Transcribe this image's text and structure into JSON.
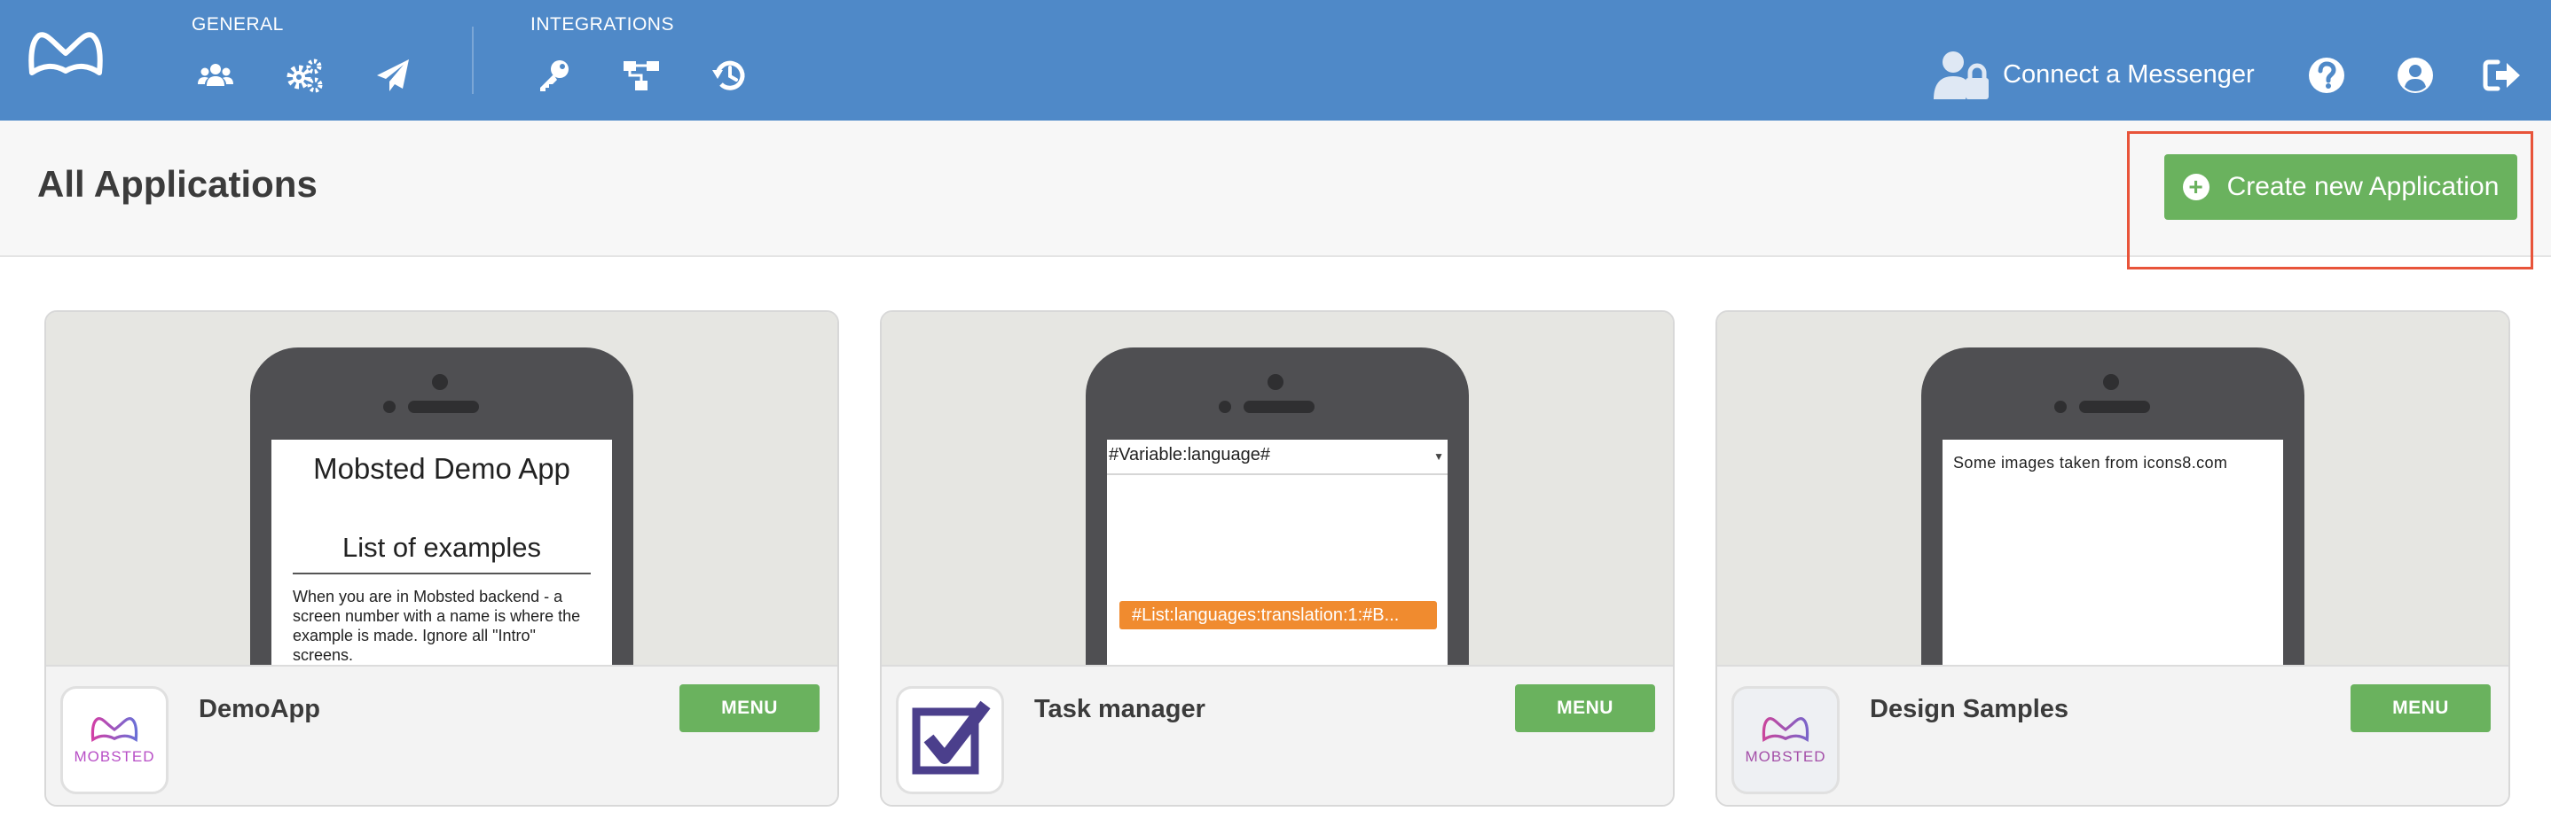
{
  "topbar": {
    "general_label": "GENERAL",
    "integrations_label": "INTEGRATIONS",
    "general_icons": [
      "users-icon",
      "cogs-icon",
      "paper-plane-icon"
    ],
    "integration_icons": [
      "key-icon",
      "sitemap-icon",
      "history-icon"
    ],
    "connect_messenger": "Connect a Messenger",
    "right_icons": [
      "help-icon",
      "user-circle-icon",
      "sign-out-icon"
    ]
  },
  "page": {
    "title": "All Applications",
    "create_button": "Create new Application",
    "create_button_icon": "plus-circle-icon"
  },
  "apps": [
    {
      "name": "DemoApp",
      "menu": "MENU",
      "icon_text": "MOBSTED",
      "preview": {
        "title": "Mobsted Demo App",
        "subtitle": "List of examples",
        "body": "When you are in Mobsted backend - a screen number with a name is where the example is made. Ignore all \"Intro\" screens."
      }
    },
    {
      "name": "Task manager",
      "menu": "MENU",
      "icon": "checkbox-icon",
      "preview": {
        "select_value": "#Variable:language#",
        "badge": "#List:languages:translation:1:#B..."
      }
    },
    {
      "name": "Design Samples",
      "menu": "MENU",
      "icon_text": "MOBSTED",
      "preview": {
        "text": "Some images taken from icons8.com"
      }
    }
  ],
  "colors": {
    "topbar": "#4f89c8",
    "button_green": "#6ab25e",
    "badge_orange": "#f08b2f",
    "highlight_red": "#e8543a"
  }
}
